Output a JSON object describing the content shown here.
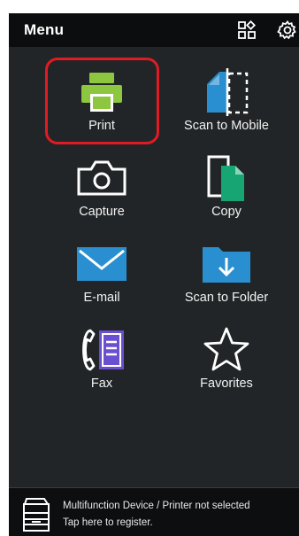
{
  "header": {
    "title": "Menu",
    "grid_icon": "apps-grid-icon",
    "settings_icon": "gear-icon"
  },
  "menu": {
    "items": [
      {
        "label": "Print",
        "icon": "printer-icon",
        "selected": true
      },
      {
        "label": "Scan to Mobile",
        "icon": "scan-to-mobile-icon"
      },
      {
        "label": "Capture",
        "icon": "camera-icon"
      },
      {
        "label": "Copy",
        "icon": "copy-icon"
      },
      {
        "label": "E-mail",
        "icon": "envelope-icon"
      },
      {
        "label": "Scan to Folder",
        "icon": "folder-download-icon"
      },
      {
        "label": "Fax",
        "icon": "fax-icon"
      },
      {
        "label": "Favorites",
        "icon": "star-icon"
      }
    ]
  },
  "footer": {
    "line1": "Multifunction Device / Printer not selected",
    "line2": "Tap here to register.",
    "icon": "printer-device-icon"
  },
  "colors": {
    "background": "#222527",
    "header": "#0c0d0e",
    "highlight": "#e01b24",
    "print_green": "#8dc63f",
    "accent_blue": "#2a8fd0",
    "copy_green": "#17a673",
    "fax_purple": "#6a4fd1"
  }
}
